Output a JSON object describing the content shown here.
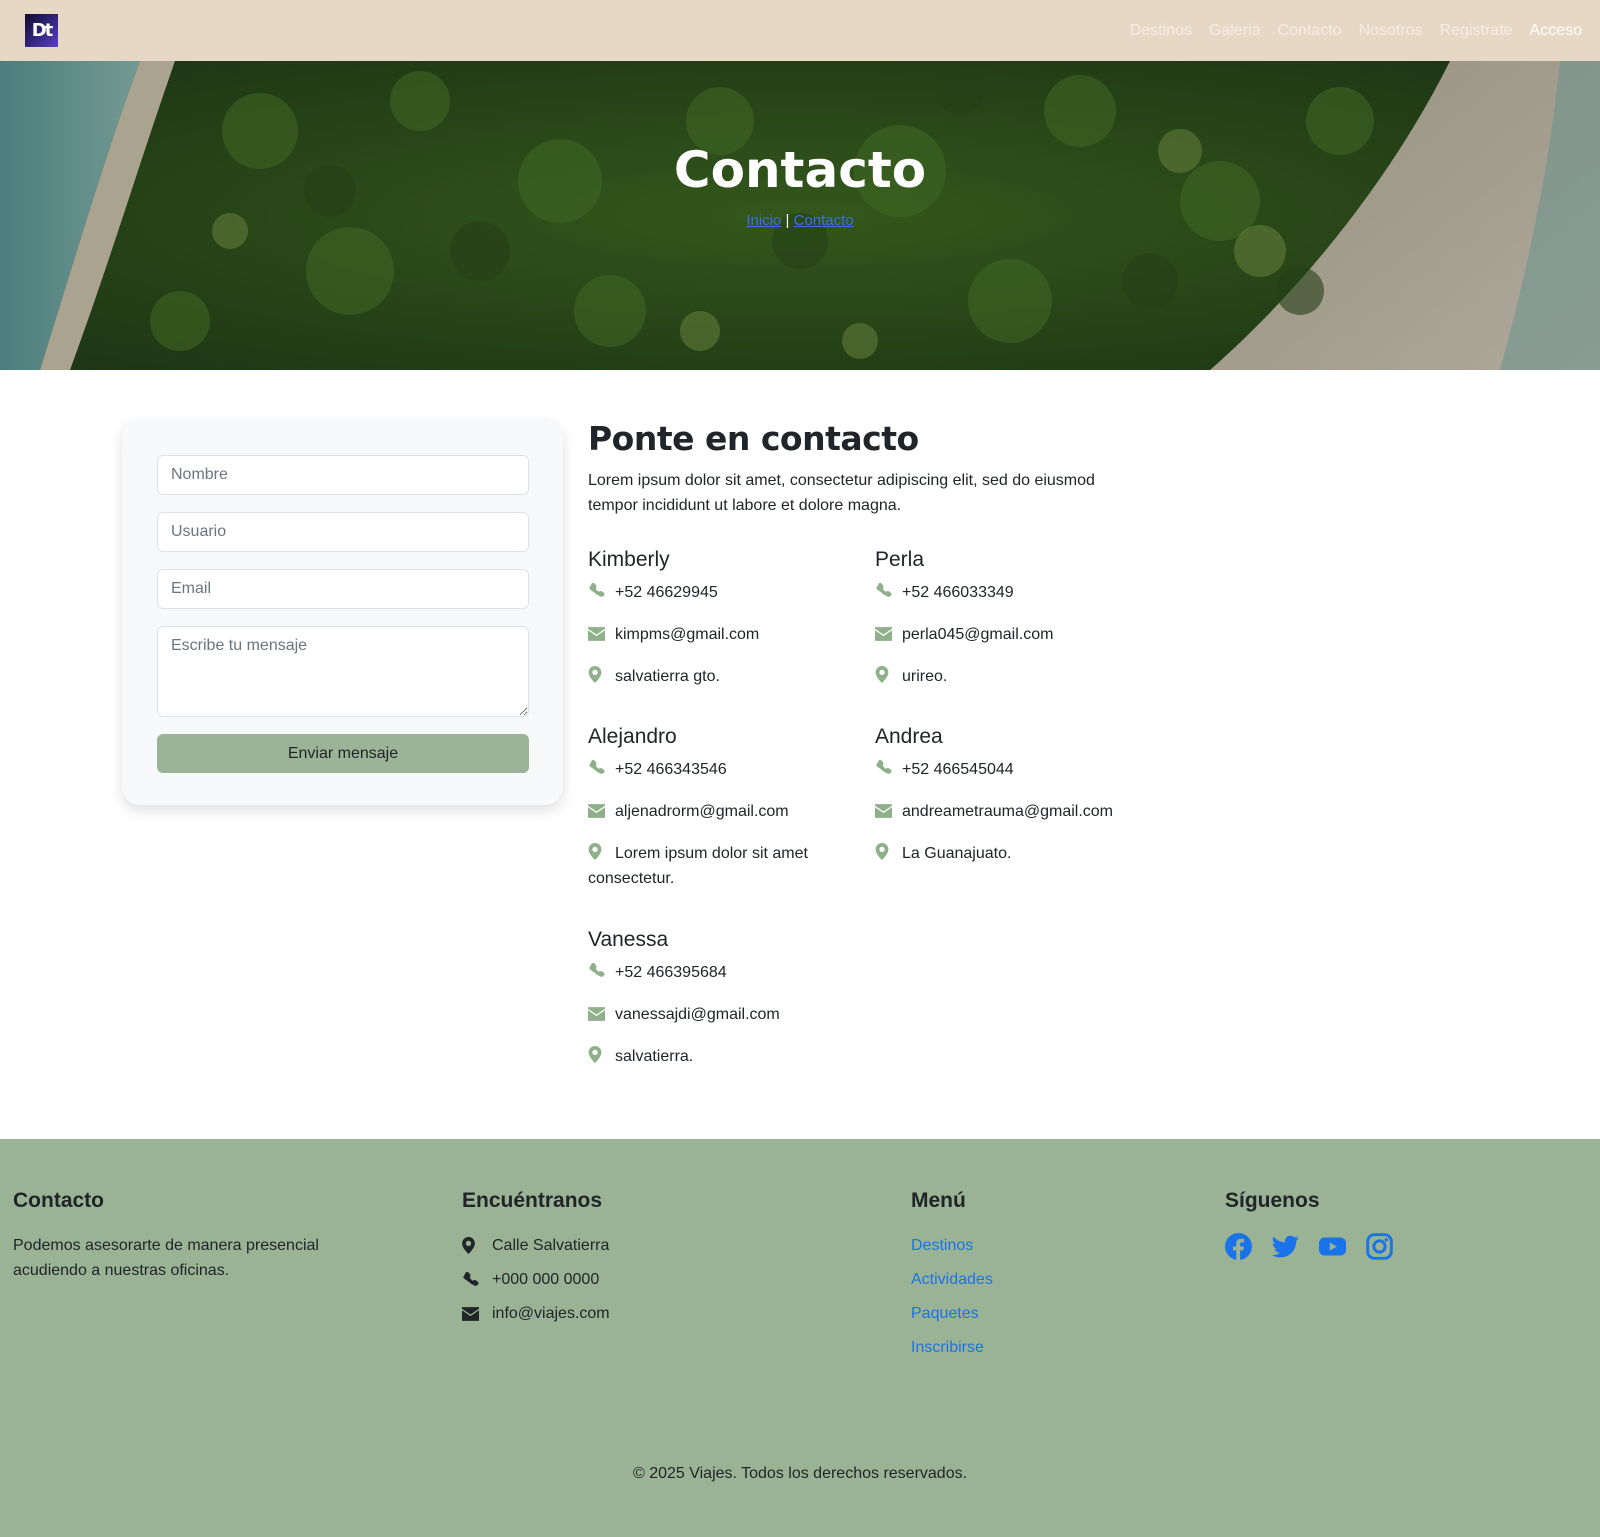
{
  "navbar": {
    "logo_text": "Dt",
    "links": [
      "Destinos",
      "Galeria",
      "Contacto",
      "Nosotros",
      "Registrate",
      "Acceso"
    ]
  },
  "hero": {
    "title": "Contacto",
    "breadcrumb_home": "Inicio",
    "breadcrumb_separator": "|",
    "breadcrumb_current": "Contacto"
  },
  "form": {
    "name_placeholder": "Nombre",
    "user_placeholder": "Usuario",
    "email_placeholder": "Email",
    "message_placeholder": "Escribe tu mensaje",
    "submit_label": "Enviar mensaje"
  },
  "contact": {
    "heading": "Ponte en contacto",
    "intro": "Lorem ipsum dolor sit amet, consectetur adipiscing elit, sed do eiusmod tempor incididunt ut labore et dolore magna.",
    "people": [
      {
        "name": "Kimberly",
        "phone": "+52 46629945",
        "email": "kimpms@gmail.com",
        "location": "salvatierra gto."
      },
      {
        "name": "Perla",
        "phone": "+52 466033349",
        "email": "perla045@gmail.com",
        "location": "urireo."
      },
      {
        "name": "Alejandro",
        "phone": "+52 466343546",
        "email": "aljenadrorm@gmail.com",
        "location": "Lorem ipsum dolor sit amet consectetur."
      },
      {
        "name": "Andrea",
        "phone": "+52 466545044",
        "email": "andreametrauma@gmail.com",
        "location": "La Guanajuato."
      },
      {
        "name": "Vanessa",
        "phone": "+52 466395684",
        "email": "vanessajdi@gmail.com",
        "location": "salvatierra."
      }
    ]
  },
  "footer": {
    "contact_title": "Contacto",
    "contact_text": "Podemos asesorarte de manera presencial acudiendo a nuestras oficinas.",
    "find_title": "Encuéntranos",
    "address": "Calle Salvatierra",
    "phone": "+000 000 0000",
    "email": "info@viajes.com",
    "menu_title": "Menú",
    "menu_items": [
      "Destinos",
      "Actividades",
      "Paquetes",
      "Inscribirse"
    ],
    "follow_title": "Síguenos",
    "social_icons": [
      "facebook-icon",
      "twitter-icon",
      "youtube-icon",
      "instagram-icon"
    ],
    "copyright": "© 2025 Viajes. Todos los derechos reservados."
  },
  "colors": {
    "navbar_bg": "#e6d8c5",
    "accent_green": "#9bb396",
    "link_blue": "#1a73e8",
    "icon_green": "#8fb08a"
  }
}
